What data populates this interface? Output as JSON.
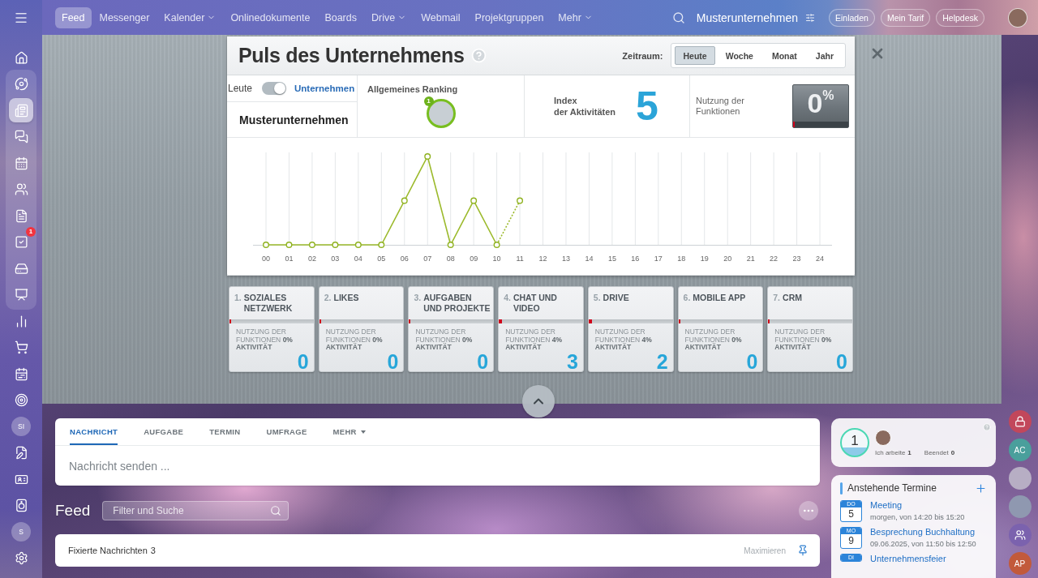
{
  "sidebar": {
    "sections": [
      {
        "grouped": false,
        "items": [
          {
            "kind": "icon",
            "selected": false
          }
        ]
      },
      {
        "grouped": true,
        "items": [
          {
            "kind": "icon",
            "selected": false
          },
          {
            "kind": "icon",
            "selected": true
          },
          {
            "kind": "icon",
            "selected": false
          },
          {
            "kind": "icon",
            "selected": false
          },
          {
            "kind": "icon",
            "selected": false
          },
          {
            "kind": "icon",
            "selected": false
          },
          {
            "kind": "icon",
            "selected": false,
            "badge": "1"
          },
          {
            "kind": "icon",
            "selected": false
          },
          {
            "kind": "icon",
            "selected": false
          }
        ]
      },
      {
        "grouped": false,
        "items": [
          {
            "kind": "icon",
            "selected": false
          },
          {
            "kind": "icon",
            "selected": false
          },
          {
            "kind": "icon",
            "selected": false
          },
          {
            "kind": "icon",
            "selected": false
          },
          {
            "kind": "initials",
            "label": "SI",
            "selected": false
          },
          {
            "kind": "icon",
            "selected": false
          },
          {
            "kind": "icon",
            "selected": false
          },
          {
            "kind": "icon",
            "selected": false
          },
          {
            "kind": "initials",
            "label": "S",
            "selected": false
          },
          {
            "kind": "icon",
            "selected": false
          }
        ]
      }
    ]
  },
  "nav": [
    {
      "label": "Feed",
      "selected": true,
      "dropdown": false
    },
    {
      "label": "Messenger",
      "selected": false,
      "dropdown": false
    },
    {
      "label": "Kalender",
      "selected": false,
      "dropdown": true
    },
    {
      "label": "Onlinedokumente",
      "selected": false,
      "dropdown": false
    },
    {
      "label": "Boards",
      "selected": false,
      "dropdown": false
    },
    {
      "label": "Drive",
      "selected": false,
      "dropdown": true
    },
    {
      "label": "Webmail",
      "selected": false,
      "dropdown": false
    },
    {
      "label": "Projektgruppen",
      "selected": false,
      "dropdown": false
    },
    {
      "label": "Mehr",
      "selected": false,
      "dropdown": true
    }
  ],
  "header": {
    "company": "Musterunternehmen",
    "buttons": [
      "Einladen",
      "Mein Tarif",
      "Helpdesk"
    ]
  },
  "pulse": {
    "title": "Puls des Unternehmens",
    "period_label": "Zeitraum:",
    "periods": [
      {
        "label": "Heute",
        "selected": true
      },
      {
        "label": "Woche",
        "selected": false
      },
      {
        "label": "Monat",
        "selected": false
      },
      {
        "label": "Jahr",
        "selected": false
      }
    ],
    "mode": {
      "left": "Leute",
      "right": "Unternehmen",
      "on": true
    },
    "company": "Musterunternehmen",
    "ranking": {
      "label": "Allgemeines Ranking",
      "rank": "1"
    },
    "index": {
      "label": "Index\nder Aktivitäten",
      "value": "5"
    },
    "usage": {
      "label": "Nutzung der\nFunktionen",
      "value": "0$^{%}$",
      "level": 0
    },
    "hours": [
      "00",
      "01",
      "02",
      "03",
      "04",
      "05",
      "06",
      "07",
      "08",
      "09",
      "10",
      "11",
      "12",
      "13",
      "14",
      "15",
      "16",
      "17",
      "18",
      "19",
      "20",
      "21",
      "22",
      "23",
      "24"
    ],
    "modules": [
      {
        "number": "1.",
        "title": "SOZIALES\nNETZWERK",
        "usage": "NUTZUNG DER\nFUNKTIONEN **0%**",
        "level": 0,
        "activity_label": "AKTIVITÄT",
        "value": "0"
      },
      {
        "number": "2.",
        "title": "LIKES",
        "usage": "NUTZUNG DER\nFUNKTIONEN **0%**",
        "level": 0,
        "activity_label": "AKTIVITÄT",
        "value": "0"
      },
      {
        "number": "3.",
        "title": "AUFGABEN\nUND PROJEKTE",
        "usage": "NUTZUNG DER\nFUNKTIONEN **0%**",
        "level": 0,
        "activity_label": "AKTIVITÄT",
        "value": "0"
      },
      {
        "number": "4.",
        "title": "CHAT UND\nVIDEO",
        "usage": "NUTZUNG DER\nFUNKTIONEN **4%**",
        "level": 0.04,
        "activity_label": "AKTIVITÄT",
        "value": "3"
      },
      {
        "number": "5.",
        "title": "DRIVE",
        "usage": "NUTZUNG DER\nFUNKTIONEN **4%**",
        "level": 0.04,
        "activity_label": "AKTIVITÄT",
        "value": "2"
      },
      {
        "number": "6.",
        "title": "MOBILE APP",
        "usage": "NUTZUNG DER\nFUNKTIONEN **0%**",
        "level": 0,
        "activity_label": "AKTIVITÄT",
        "value": "0"
      },
      {
        "number": "7.",
        "title": "CRM",
        "usage": "NUTZUNG DER\nFUNKTIONEN **0%**",
        "level": 0,
        "activity_label": "AKTIVITÄT",
        "value": "0"
      }
    ]
  },
  "composer": {
    "tabs": [
      {
        "label": "NACHRICHT",
        "selected": true,
        "dropdown": false
      },
      {
        "label": "AUFGABE",
        "selected": false,
        "dropdown": false
      },
      {
        "label": "TERMIN",
        "selected": false,
        "dropdown": false
      },
      {
        "label": "UMFRAGE",
        "selected": false,
        "dropdown": false
      },
      {
        "label": "MEHR",
        "selected": false,
        "dropdown": true
      }
    ],
    "placeholder": "Nachricht senden ..."
  },
  "feed": {
    "title": "Feed",
    "search_placeholder": "Filter und Suche",
    "pinned_label": "Fixierte Nachrichten",
    "pinned_count": "3",
    "pinned_action": "Maximieren"
  },
  "work_time": {
    "counter": "1",
    "working_label": "Ich arbeite",
    "working_count": "1",
    "finished_label": "Beendet",
    "finished_count": "0"
  },
  "events": {
    "title": "Anstehende Termine",
    "items": [
      {
        "weekday": "DO",
        "day": "5",
        "title": "Meeting",
        "time": "morgen, von 14:20 bis 15:20"
      },
      {
        "weekday": "MO",
        "day": "9",
        "title": "Besprechung Buchhaltung",
        "time": "09.06.2025, von 11:50 bis 12:50"
      },
      {
        "weekday": "DI",
        "title": "Unternehmensfeier"
      }
    ]
  },
  "right_rail": [
    {
      "kind": "icon",
      "color": "#c2475b"
    },
    {
      "kind": "initials",
      "label": "AC",
      "color": "#4a9f9c"
    },
    {
      "kind": "group"
    },
    {
      "kind": "avatar"
    },
    {
      "kind": "icon",
      "color": "#7b62ae"
    },
    {
      "kind": "initials",
      "label": "AP",
      "color": "#c25a3b"
    }
  ]
}
